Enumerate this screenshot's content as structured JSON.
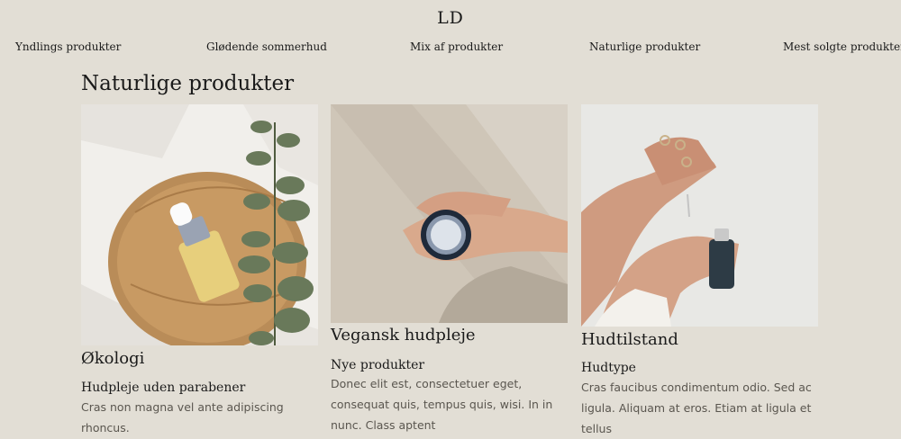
{
  "header": {
    "logo": "LD"
  },
  "nav": {
    "items": [
      {
        "label": "Yndlings produkter"
      },
      {
        "label": "Glødende sommerhud"
      },
      {
        "label": "Mix af produkter"
      },
      {
        "label": "Naturlige produkter"
      },
      {
        "label": "Mest solgte produkter"
      }
    ]
  },
  "section": {
    "title": "Naturlige produkter"
  },
  "cards": [
    {
      "title": "Økologi",
      "subtitle": "Hudpleje uden parabener",
      "body": "Cras non magna vel ante adipiscing rhoncus."
    },
    {
      "title": "Vegansk hudpleje",
      "subtitle": "Nye produkter",
      "body": "Donec elit est, consectetuer eget, consequat quis, tempus quis, wisi. In in nunc. Class aptent"
    },
    {
      "title": "Hudtilstand",
      "subtitle": "Hudtype",
      "body": "Cras faucibus condimentum odio. Sed ac ligula. Aliquam at eros. Etiam at ligula et tellus"
    }
  ],
  "colors": {
    "background": "#e2ded5",
    "text": "#1a1a1a",
    "body_text": "#5a564f"
  }
}
